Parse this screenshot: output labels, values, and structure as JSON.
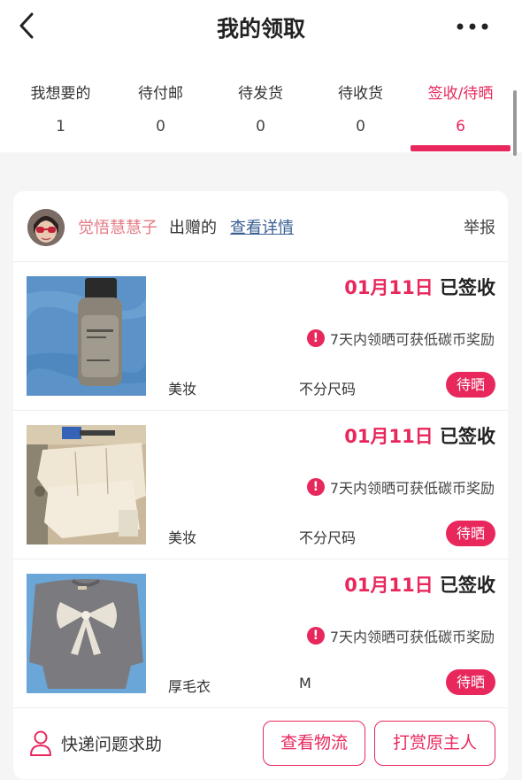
{
  "header": {
    "title": "我的领取",
    "back_icon": "chevron-left-icon",
    "more_icon": "more-dots-icon"
  },
  "tabs": [
    {
      "label": "我想要的",
      "count": "1"
    },
    {
      "label": "待付邮",
      "count": "0"
    },
    {
      "label": "待发货",
      "count": "0"
    },
    {
      "label": "待收货",
      "count": "0"
    },
    {
      "label": "签收/待晒",
      "count": "6",
      "active": true
    }
  ],
  "card": {
    "giver_name": "觉悟慧慧子",
    "giver_action": "出赠的",
    "view_detail": "查看详情",
    "report": "举报",
    "items": [
      {
        "date": "01月11日",
        "status": "已签收",
        "tip": "7天内领晒可获低碳币奖励",
        "category": "美妆",
        "size": "不分尺码",
        "badge": "待晒",
        "thumb": "bottle-photo"
      },
      {
        "date": "01月11日",
        "status": "已签收",
        "tip": "7天内领晒可获低碳币奖励",
        "category": "美妆",
        "size": "不分尺码",
        "badge": "待晒",
        "thumb": "mask-packets-photo"
      },
      {
        "date": "01月11日",
        "status": "已签收",
        "tip": "7天内领晒可获低碳币奖励",
        "category": "厚毛衣",
        "size": "M",
        "badge": "待晒",
        "thumb": "bow-sweater-photo"
      }
    ],
    "footer": {
      "help_label": "快递问题求助",
      "logistics_button": "查看物流",
      "reward_button": "打赏原主人"
    }
  },
  "colors": {
    "accent": "#e8285c",
    "giver_name": "#e37b85",
    "link": "#3a5f93"
  }
}
